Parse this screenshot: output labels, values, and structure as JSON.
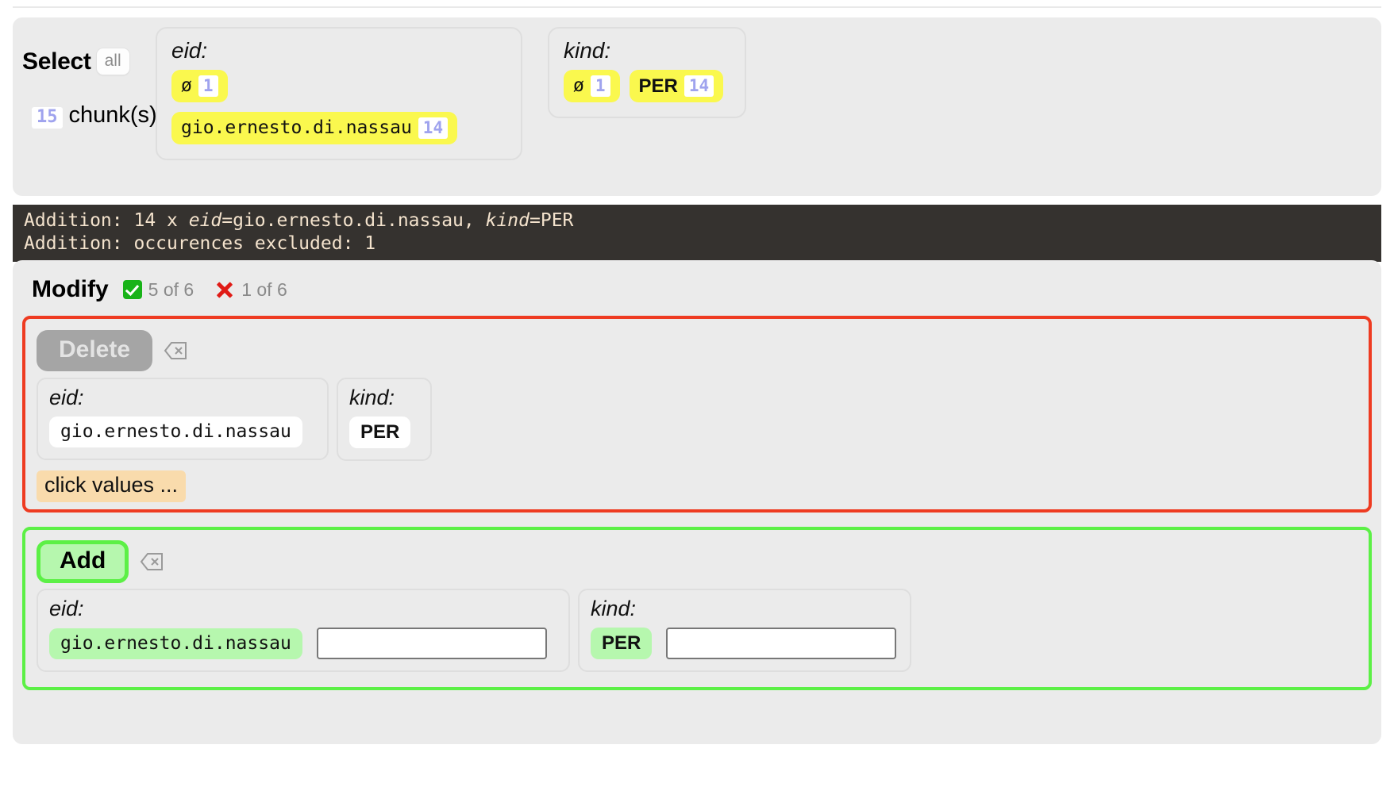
{
  "select": {
    "title": "Select",
    "all_button": "all",
    "chunk_count": "15",
    "chunk_label": "chunk(s)",
    "facets": [
      {
        "label": "eid:",
        "chips": [
          {
            "text": "ø",
            "count": "1"
          },
          {
            "text": "gio.ernesto.di.nassau",
            "count": "14"
          }
        ]
      },
      {
        "label": "kind:",
        "chips": [
          {
            "text": "ø",
            "count": "1"
          },
          {
            "text": "PER",
            "count": "14"
          }
        ]
      }
    ]
  },
  "log": {
    "line1_prefix": "Addition: 14 x ",
    "line1_key1": "eid",
    "line1_mid": "=gio.ernesto.di.nassau, ",
    "line1_key2": "kind",
    "line1_suffix": "=PER",
    "line2": "Addition: occurences excluded: 1"
  },
  "modify": {
    "title": "Modify",
    "success_text": "5 of 6",
    "failure_text": "1 of 6",
    "success_icon": "check-icon",
    "failure_icon": "cross-icon",
    "delete": {
      "button_label": "Delete",
      "erase_icon": "erase-icon",
      "eid_label": "eid:",
      "eid_value": "gio.ernesto.di.nassau",
      "kind_label": "kind:",
      "kind_value": "PER",
      "hint": "click values ..."
    },
    "add": {
      "button_label": "Add",
      "erase_icon": "erase-icon",
      "eid_label": "eid:",
      "eid_value": "gio.ernesto.di.nassau",
      "eid_input_value": "",
      "eid_input_placeholder": "",
      "kind_label": "kind:",
      "kind_value": "PER",
      "kind_input_value": "",
      "kind_input_placeholder": ""
    }
  },
  "colors": {
    "chip_yellow": "#faf84e",
    "count_purple": "#9fa3ee",
    "delete_border": "#ee3b21",
    "add_border": "#5cf046",
    "add_fill": "#b6f7ae",
    "hint_bg": "#f9dbac",
    "log_bg": "#35322f",
    "log_fg": "#f4e3cd"
  }
}
